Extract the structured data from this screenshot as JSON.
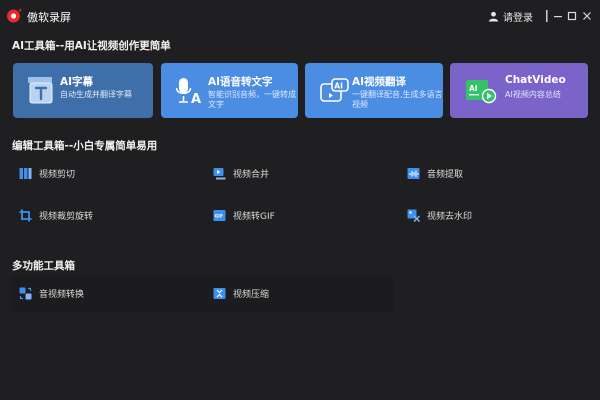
{
  "app": {
    "title": "傲软录屏"
  },
  "header": {
    "login_label": "请登录"
  },
  "sections": {
    "ai": "AI工具箱--用AI让视频创作更简单",
    "edit": "编辑工具箱--小白专属简单易用",
    "multi": "多功能工具箱"
  },
  "ai_cards": [
    {
      "title": "AI字幕",
      "desc": "自动生成并翻译字幕",
      "icon": "subtitle-icon"
    },
    {
      "title": "AI语音转文字",
      "desc": "智能识别音频，一键转成文字",
      "icon": "microphone-text-icon"
    },
    {
      "title": "AI视频翻译",
      "desc": "一键翻译配音,生成多语言视频",
      "icon": "ai-video-translate-icon"
    },
    {
      "title": "ChatVideo",
      "desc": "AI视频内容总结",
      "icon": "chat-video-icon"
    }
  ],
  "edit_tools": [
    {
      "label": "视频剪切",
      "icon": "video-cut-icon"
    },
    {
      "label": "视频合并",
      "icon": "video-merge-icon"
    },
    {
      "label": "音频提取",
      "icon": "audio-extract-icon"
    },
    {
      "label": "视频裁剪旋转",
      "icon": "crop-rotate-icon"
    },
    {
      "label": "视频转GIF",
      "icon": "video-to-gif-icon"
    },
    {
      "label": "视频去水印",
      "icon": "remove-watermark-icon"
    }
  ],
  "multi_tools": [
    {
      "label": "音视频转换",
      "icon": "format-convert-icon"
    },
    {
      "label": "视频压缩",
      "icon": "video-compress-icon"
    }
  ],
  "colors": {
    "background": "#1f1f21",
    "card_blue_muted": "#3f6fa8",
    "card_blue": "#4a8de3",
    "card_purple": "#7b64c9",
    "icon_blue": "#3d8ff0",
    "brand_red": "#e82a2a"
  }
}
